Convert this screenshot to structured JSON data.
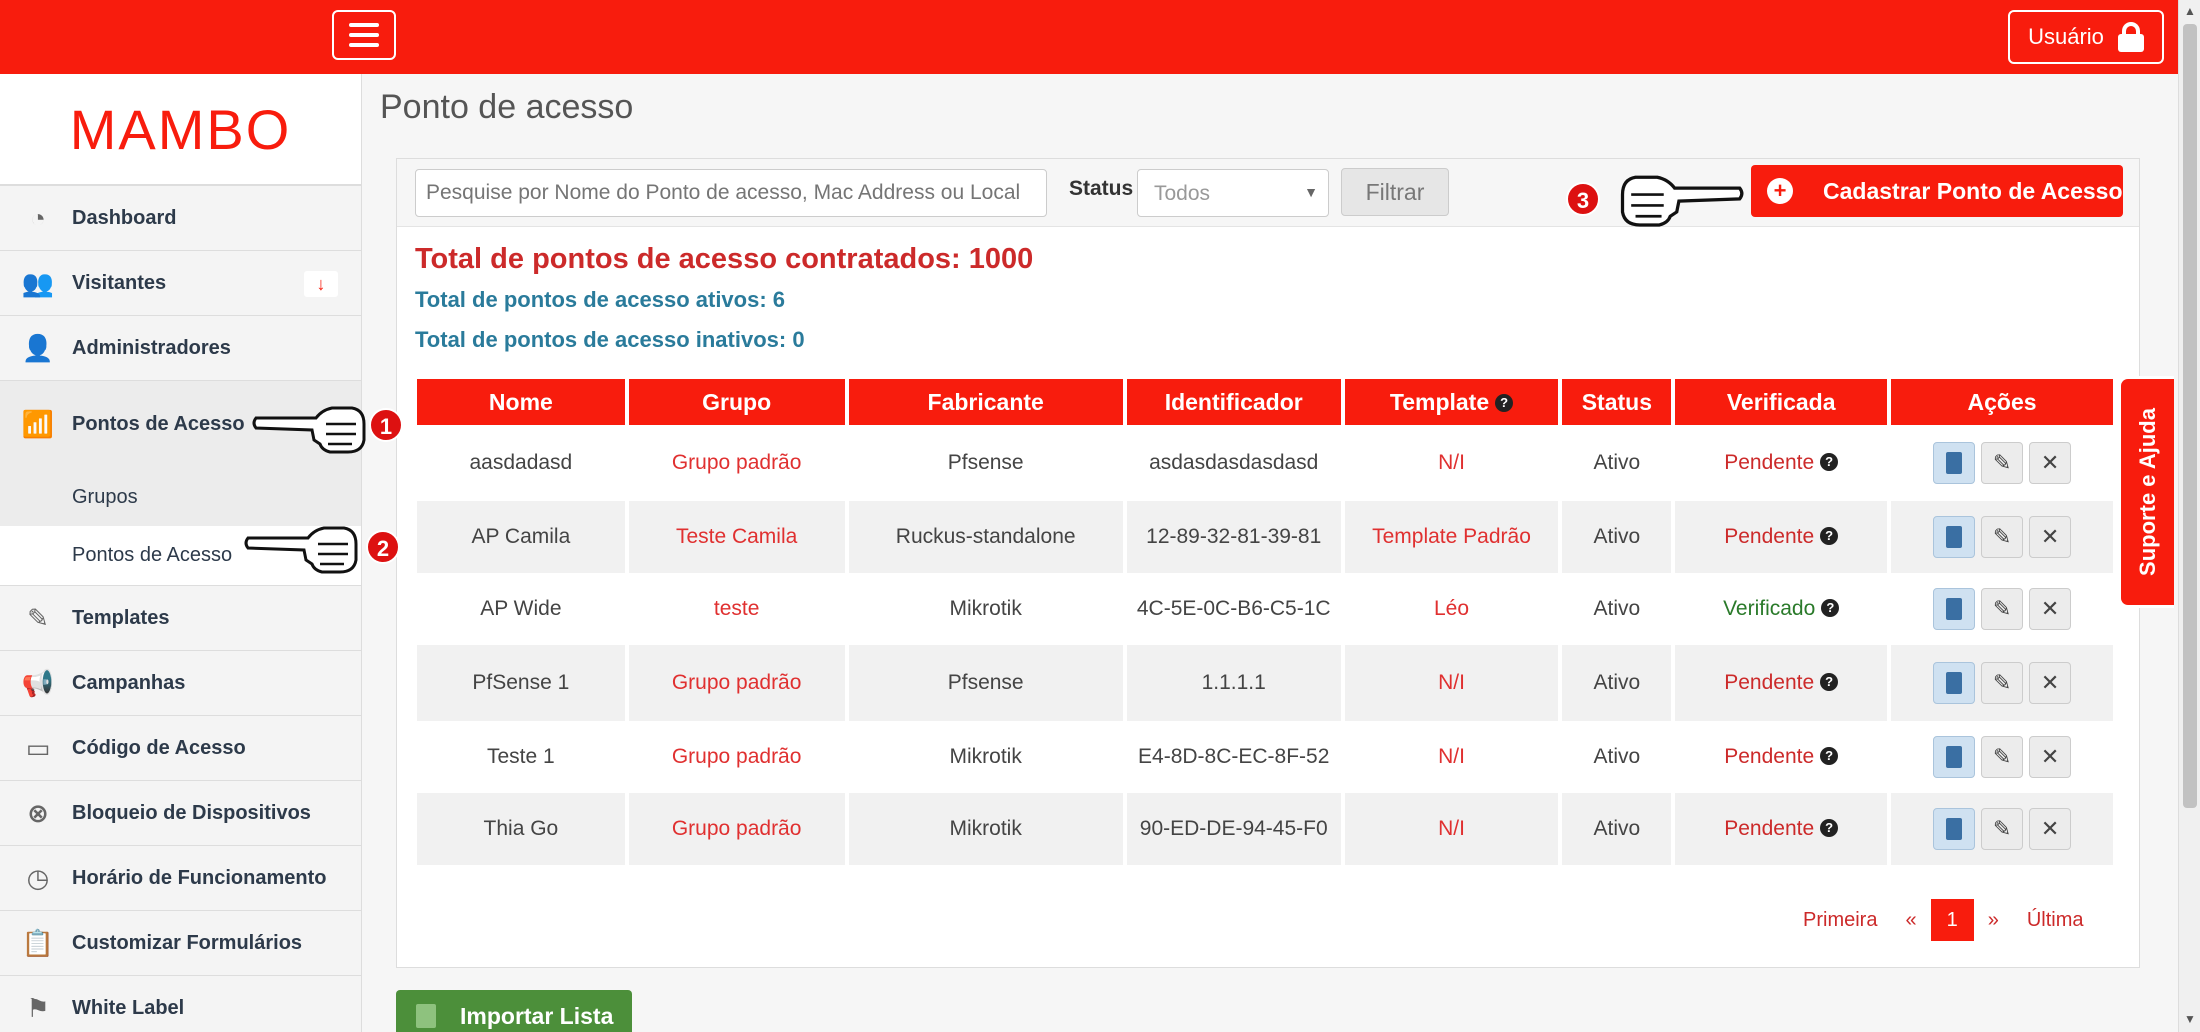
{
  "topbar": {
    "user_label": "Usuário"
  },
  "brand": {
    "logo_text": "MAMBO"
  },
  "sidebar": {
    "items": [
      {
        "label": "Dashboard",
        "icon": "dashboard-icon"
      },
      {
        "label": "Visitantes",
        "icon": "users-icon"
      },
      {
        "label": "Administradores",
        "icon": "user-icon"
      },
      {
        "label": "Pontos de Acesso",
        "icon": "router-icon"
      },
      {
        "label": "Templates",
        "icon": "pencil-icon"
      },
      {
        "label": "Campanhas",
        "icon": "megaphone-icon"
      },
      {
        "label": "Código de Acesso",
        "icon": "card-icon"
      },
      {
        "label": "Bloqueio de Dispositivos",
        "icon": "block-icon"
      },
      {
        "label": "Horário de Funcionamento",
        "icon": "clock-icon"
      },
      {
        "label": "Customizar Formulários",
        "icon": "clipboard-icon"
      },
      {
        "label": "White Label",
        "icon": "flag-icon"
      }
    ],
    "visitantes_badge": "↓",
    "sub_items": [
      {
        "label": "Grupos"
      },
      {
        "label": "Pontos de Acesso"
      }
    ]
  },
  "page": {
    "title": "Ponto de acesso"
  },
  "filter": {
    "search_placeholder": "Pesquise por Nome do Ponto de acesso, Mac Address ou Local",
    "status_label": "Status",
    "status_value": "Todos",
    "filter_button": "Filtrar",
    "register_button": "Cadastrar Ponto de Acesso"
  },
  "totals": {
    "contracted": "Total de pontos de acesso contratados: 1000",
    "active": "Total de pontos de acesso ativos: 6",
    "inactive": "Total de pontos de acesso inativos: 0"
  },
  "table": {
    "headers": [
      "Nome",
      "Grupo",
      "Fabricante",
      "Identificador",
      "Template",
      "Status",
      "Verificada",
      "Ações"
    ],
    "rows": [
      {
        "nome": "aasdadasd",
        "grupo": "Grupo padrão",
        "fabricante": "Pfsense",
        "identificador": "asdasdasdasdasd",
        "template": "N/I",
        "status": "Ativo",
        "verificada": "Pendente"
      },
      {
        "nome": "AP Camila",
        "grupo": "Teste Camila",
        "fabricante": "Ruckus-standalone",
        "identificador": "12-89-32-81-39-81",
        "template": "Template Padrão",
        "status": "Ativo",
        "verificada": "Pendente"
      },
      {
        "nome": "AP Wide",
        "grupo": "teste",
        "fabricante": "Mikrotik",
        "identificador": "4C-5E-0C-B6-C5-1C",
        "template": "Léo",
        "status": "Ativo",
        "verificada": "Verificado"
      },
      {
        "nome": "PfSense 1",
        "grupo": "Grupo padrão",
        "fabricante": "Pfsense",
        "identificador": "1.1.1.1",
        "template": "N/I",
        "status": "Ativo",
        "verificada": "Pendente"
      },
      {
        "nome": "Teste 1",
        "grupo": "Grupo padrão",
        "fabricante": "Mikrotik",
        "identificador": "E4-8D-8C-EC-8F-52",
        "template": "N/I",
        "status": "Ativo",
        "verificada": "Pendente"
      },
      {
        "nome": "Thia Go",
        "grupo": "Grupo padrão",
        "fabricante": "Mikrotik",
        "identificador": "90-ED-DE-94-45-F0",
        "template": "N/I",
        "status": "Ativo",
        "verificada": "Pendente"
      }
    ]
  },
  "pagination": {
    "first": "Primeira",
    "prev": "«",
    "current": "1",
    "next": "»",
    "last": "Última"
  },
  "import_button": "Importar Lista",
  "support_tab": "Suporte e Ajuda",
  "callouts": [
    "1",
    "2",
    "3"
  ],
  "colors": {
    "brand_red": "#f81c0d",
    "link_red": "#e03030",
    "info_blue": "#2a7b9b",
    "success_green": "#4c8f3a"
  }
}
